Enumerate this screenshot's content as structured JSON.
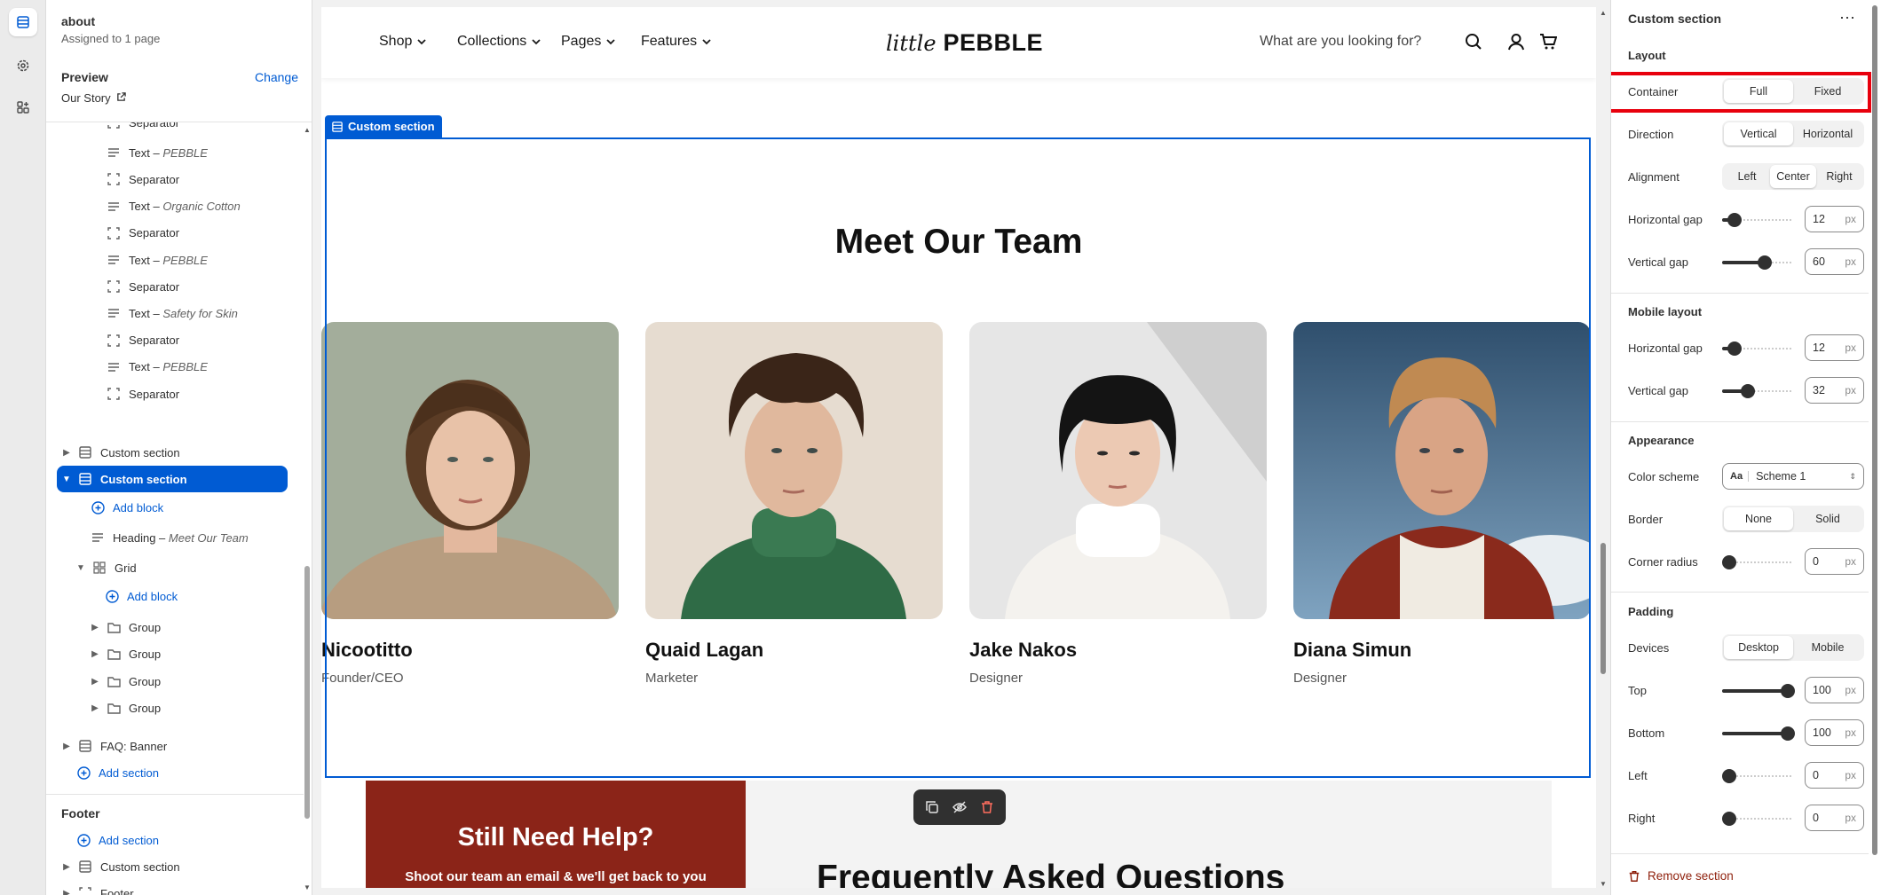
{
  "left_panel": {
    "page_title": "about",
    "assigned": "Assigned to 1 page",
    "preview_label": "Preview",
    "change_label": "Change",
    "preview_page": "Our Story",
    "tree": [
      {
        "type": "separator",
        "label": "Separator"
      },
      {
        "type": "text",
        "label": "Text",
        "detail": "PEBBLE"
      },
      {
        "type": "separator",
        "label": "Separator"
      },
      {
        "type": "text",
        "label": "Text",
        "detail": "Organic Cotton"
      },
      {
        "type": "separator",
        "label": "Separator"
      },
      {
        "type": "text",
        "label": "Text",
        "detail": "PEBBLE"
      },
      {
        "type": "separator",
        "label": "Separator"
      },
      {
        "type": "text",
        "label": "Text",
        "detail": "Safety for Skin"
      },
      {
        "type": "separator",
        "label": "Separator"
      },
      {
        "type": "text",
        "label": "Text",
        "detail": "PEBBLE"
      },
      {
        "type": "separator",
        "label": "Separator"
      }
    ],
    "custom_section_1": "Custom section",
    "custom_section_selected": "Custom section",
    "add_block_1": "Add block",
    "heading_label": "Heading",
    "heading_detail": "Meet Our Team",
    "grid_label": "Grid",
    "add_block_2": "Add block",
    "groups": [
      "Group",
      "Group",
      "Group",
      "Group"
    ],
    "faq_banner": "FAQ: Banner",
    "add_section": "Add section",
    "footer_label": "Footer",
    "footer_add_section": "Add section",
    "footer_custom_section": "Custom section",
    "footer_item": "Footer"
  },
  "store": {
    "nav": [
      "Shop",
      "Collections",
      "Pages",
      "Features"
    ],
    "logo_script": "little",
    "logo_bold": "PEBBLE",
    "search_placeholder": "What are you looking for?",
    "section_tag": "Custom section",
    "team_heading": "Meet Our Team",
    "team": [
      {
        "name": "Nicootitto",
        "role": "Founder/CEO"
      },
      {
        "name": "Quaid Lagan",
        "role": "Marketer"
      },
      {
        "name": "Jake Nakos",
        "role": "Designer"
      },
      {
        "name": "Diana Simun",
        "role": "Designer"
      }
    ],
    "help_title": "Still Need Help?",
    "help_sub": "Shoot our team an email & we'll get back to you",
    "faq_title": "Frequently Asked Questions"
  },
  "right_panel": {
    "title": "Custom section",
    "layout_heading": "Layout",
    "container_label": "Container",
    "container_options": [
      "Full",
      "Fixed"
    ],
    "container_selected": "Full",
    "direction_label": "Direction",
    "direction_options": [
      "Vertical",
      "Horizontal"
    ],
    "direction_selected": "Vertical",
    "alignment_label": "Alignment",
    "alignment_options": [
      "Left",
      "Center",
      "Right"
    ],
    "alignment_selected": "Center",
    "hgap_label": "Horizontal gap",
    "hgap_value": "12",
    "vgap_label": "Vertical gap",
    "vgap_value": "60",
    "mobile_heading": "Mobile layout",
    "m_hgap_label": "Horizontal gap",
    "m_hgap_value": "12",
    "m_vgap_label": "Vertical gap",
    "m_vgap_value": "32",
    "appearance_heading": "Appearance",
    "color_scheme_label": "Color scheme",
    "color_scheme_value": "Scheme 1",
    "border_label": "Border",
    "border_options": [
      "None",
      "Solid"
    ],
    "border_selected": "None",
    "corner_label": "Corner radius",
    "corner_value": "0",
    "padding_heading": "Padding",
    "devices_label": "Devices",
    "devices_options": [
      "Desktop",
      "Mobile"
    ],
    "devices_selected": "Desktop",
    "top_label": "Top",
    "top_value": "100",
    "bottom_label": "Bottom",
    "bottom_value": "100",
    "left_label": "Left",
    "left_value": "0",
    "right_label": "Right",
    "right_value": "0",
    "unit": "px",
    "remove_label": "Remove section"
  },
  "colors": {
    "accent": "#005bd3",
    "highlight": "#e8000d",
    "help_bg": "#8b2418"
  }
}
